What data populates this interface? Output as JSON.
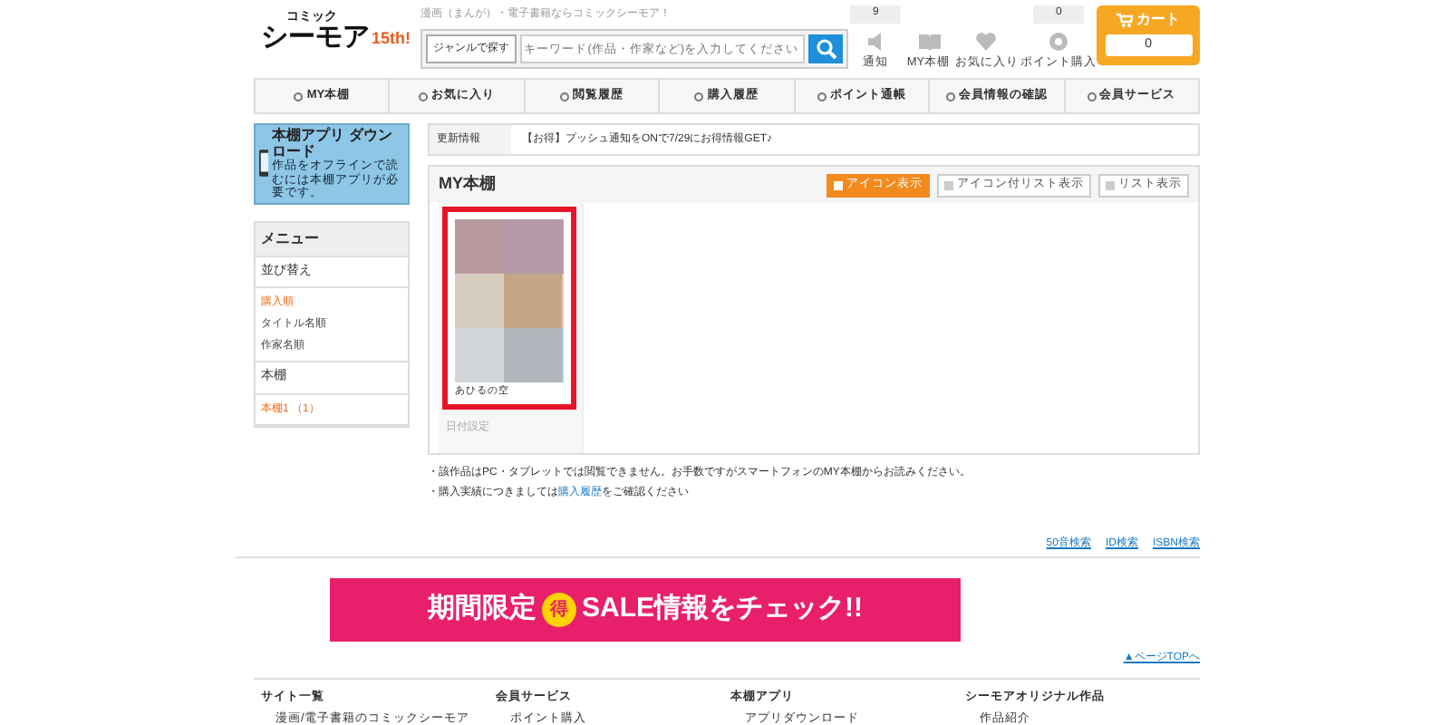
{
  "header": {
    "logo_small": "コミック",
    "logo_main": "シーモア",
    "logo_badge": "15th!",
    "tagline": "漫画（まんが）・電子書籍ならコミックシーモア！",
    "genre_button": "ジャンルで探す",
    "search": {
      "placeholder": "キーワード(作品・作家など)を入力してください"
    },
    "shortcuts": [
      {
        "label": "通知",
        "count": "9"
      },
      {
        "label": "MY本棚"
      },
      {
        "label": "お気に入り"
      },
      {
        "label": "ポイント購入",
        "count": "0"
      }
    ],
    "cart": {
      "label": "カート",
      "count": "0"
    }
  },
  "nav": [
    "MY本棚",
    "お気に入り",
    "閲覧履歴",
    "購入履歴",
    "ポイント通帳",
    "会員情報の確認",
    "会員サービス"
  ],
  "app_banner": {
    "title": "本棚アプリ ダウンロード",
    "note": "作品をオフラインで読むには本棚アプリが必要です。"
  },
  "menu": {
    "title": "メニュー",
    "sections": [
      {
        "title": "並び替え",
        "items": [
          {
            "label": "購入順",
            "selected": true
          },
          {
            "label": "タイトル名順",
            "selected": false
          },
          {
            "label": "作家名順",
            "selected": false
          }
        ]
      },
      {
        "title": "本棚",
        "items": [
          {
            "label": "本棚1 （1）",
            "selected": true
          }
        ]
      }
    ]
  },
  "update_info": {
    "label": "更新情報",
    "text": "【お得】プッシュ通知をONで7/29にお得情報GET♪"
  },
  "shelf": {
    "title": "MY本棚",
    "views": [
      {
        "label": "アイコン表示",
        "selected": true
      },
      {
        "label": "アイコン付リスト表示",
        "selected": false
      },
      {
        "label": "リスト表示",
        "selected": false
      }
    ],
    "books": [
      {
        "title": "あひるの空",
        "date": "日付設定",
        "selected": true
      }
    ]
  },
  "notes": [
    {
      "text": "・該作品はPC・タブレットでは閲覧できません。お手数ですがスマートフォンのMY本棚からお読みください。"
    },
    {
      "text": "・購入実績につきましては",
      "link": "購入履歴",
      "after": "をご確認ください"
    }
  ],
  "search_links": [
    "50音検索",
    "ID検索",
    "ISBN検索"
  ],
  "sale_banner": {
    "before": "期間限定",
    "mark": "得",
    "after": "SALE情報をチェック!!"
  },
  "page_top": "▲ページTOPへ",
  "footer": [
    {
      "title": "サイト一覧",
      "items": [
        "漫画/電子書籍のコミックシーモア"
      ]
    },
    {
      "title": "会員サービス",
      "items": [
        "ポイント購入"
      ]
    },
    {
      "title": "本棚アプリ",
      "items": [
        "アプリダウンロード"
      ]
    },
    {
      "title": "シーモアオリジナル作品",
      "items": [
        "作品紹介"
      ]
    }
  ]
}
